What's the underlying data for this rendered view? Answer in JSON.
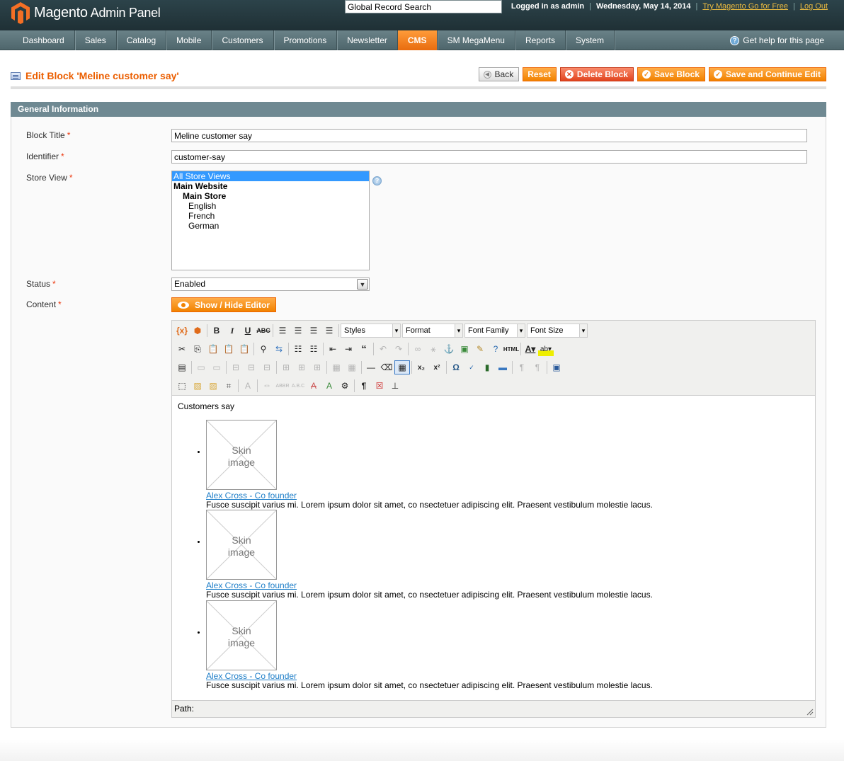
{
  "header": {
    "logo_brand": "Magento",
    "logo_sub": "Admin Panel",
    "search_value": "Global Record Search",
    "logged_in": "Logged in as admin",
    "date": "Wednesday, May 14, 2014",
    "try_link": "Try Magento Go for Free",
    "logout_link": "Log Out"
  },
  "nav": {
    "items": [
      "Dashboard",
      "Sales",
      "Catalog",
      "Mobile",
      "Customers",
      "Promotions",
      "Newsletter",
      "CMS",
      "SM MegaMenu",
      "Reports",
      "System"
    ],
    "active": "CMS",
    "help": "Get help for this page"
  },
  "page": {
    "title": "Edit Block 'Meline customer say'",
    "buttons": {
      "back": "Back",
      "reset": "Reset",
      "delete": "Delete Block",
      "save": "Save Block",
      "save_continue": "Save and Continue Edit"
    }
  },
  "form": {
    "section_title": "General Information",
    "block_title_label": "Block Title",
    "block_title_value": "Meline customer say",
    "identifier_label": "Identifier",
    "identifier_value": "customer-say",
    "store_view_label": "Store View",
    "store_options": [
      "All Store Views",
      "Main Website",
      "Main Store",
      "English",
      "French",
      "German"
    ],
    "status_label": "Status",
    "status_value": "Enabled",
    "content_label": "Content",
    "required_mark": "*",
    "show_hide_editor": "Show / Hide Editor"
  },
  "editor": {
    "styles": "Styles",
    "format": "Format",
    "font_family": "Font Family",
    "font_size": "Font Size",
    "intro": "Customers say",
    "skin_label_1": "Skin",
    "skin_label_2": "image",
    "testimonials": [
      {
        "author": "Alex Cross - Co founder",
        "quote": "Fusce suscipit varius mi. Lorem ipsum dolor sit amet, co nsectetuer adipiscing elit. Praesent vestibulum molestie lacus."
      },
      {
        "author": "Alex Cross - Co founder",
        "quote": "Fusce suscipit varius mi. Lorem ipsum dolor sit amet, co nsectetuer adipiscing elit. Praesent vestibulum molestie lacus."
      },
      {
        "author": "Alex Cross - Co founder",
        "quote": "Fusce suscipit varius mi. Lorem ipsum dolor sit amet, co nsectetuer adipiscing elit. Praesent vestibulum molestie lacus."
      }
    ],
    "path_label": "Path:"
  },
  "colors": {
    "header_bg": "#24373d",
    "nav_bg": "#5b7379",
    "accent_orange": "#f18200",
    "title_orange": "#eb5e00",
    "section_bg": "#6f8992",
    "link_blue": "#1e7ec8",
    "selected_blue": "#3399ff"
  }
}
